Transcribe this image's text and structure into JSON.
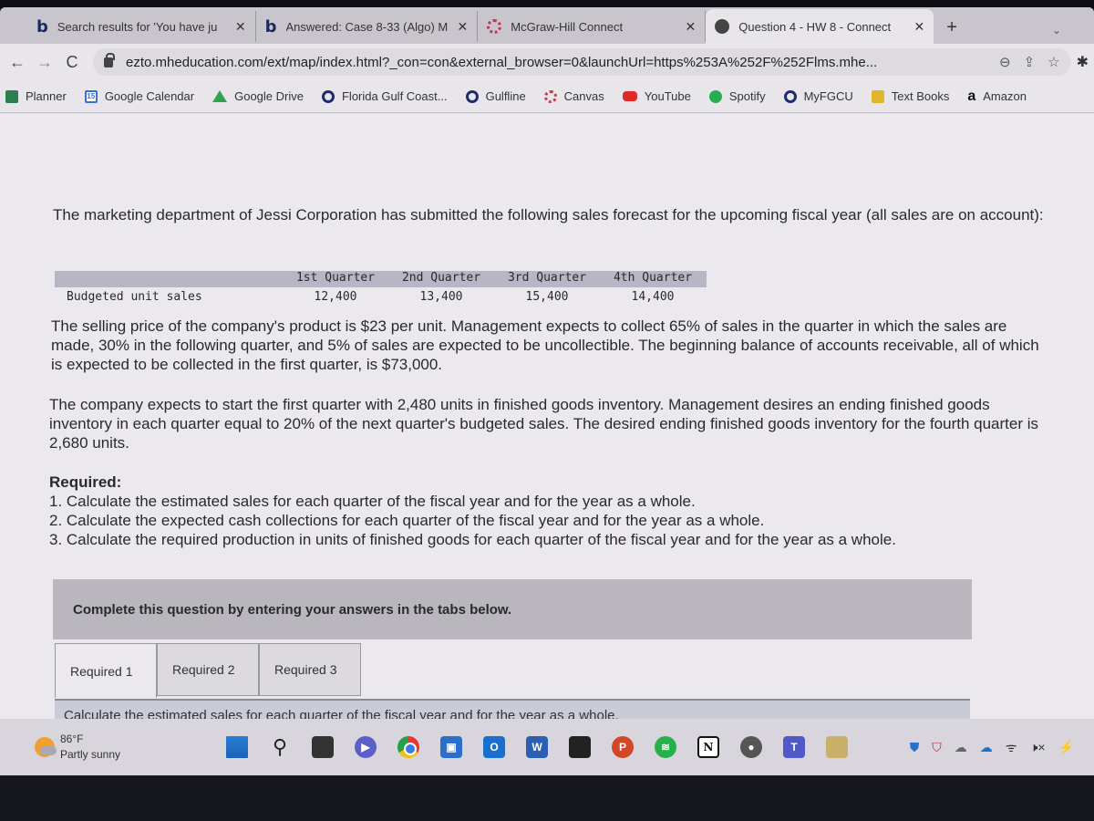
{
  "browser": {
    "tabs": [
      {
        "icon": "bing-icon",
        "favicon_glyph": "b",
        "label": "Search results for 'You have ju",
        "active": false
      },
      {
        "icon": "bing-icon",
        "favicon_glyph": "b",
        "label": "Answered: Case 8-33 (Algo) M",
        "active": false
      },
      {
        "icon": "mcgraw-hill-icon",
        "label": "McGraw-Hill Connect",
        "active": false
      },
      {
        "icon": "globe-icon",
        "label": "Question 4 - HW 8 - Connect",
        "active": true
      }
    ],
    "close_glyph": "✕",
    "new_tab_glyph": "+",
    "tab_dropdown_glyph": "⌄",
    "nav": {
      "back": "←",
      "forward": "→",
      "reload": "C"
    },
    "url": "ezto.mheducation.com/ext/map/index.html?_con=con&external_browser=0&launchUrl=https%253A%252F%252Flms.mhe...",
    "omnibox_icons": {
      "zoom": "⊖",
      "share": "⇪",
      "star": "☆",
      "extensions": "✱"
    },
    "bookmarks": [
      {
        "icon": "planner-icon",
        "label": "Planner"
      },
      {
        "icon": "google-calendar-icon",
        "label": "Google Calendar",
        "icon_text": "15"
      },
      {
        "icon": "google-drive-icon",
        "label": "Google Drive"
      },
      {
        "icon": "fgcu-icon",
        "label": "Florida Gulf Coast..."
      },
      {
        "icon": "fgcu-icon",
        "label": "Gulfline"
      },
      {
        "icon": "canvas-icon",
        "label": "Canvas"
      },
      {
        "icon": "youtube-icon",
        "label": "YouTube"
      },
      {
        "icon": "spotify-icon",
        "label": "Spotify"
      },
      {
        "icon": "fgcu-icon",
        "label": "MyFGCU"
      },
      {
        "icon": "text-books-icon",
        "label": "Text Books"
      },
      {
        "icon": "amazon-icon",
        "label": "Amazon",
        "icon_text": "a"
      }
    ]
  },
  "question": {
    "intro": "The marketing department of Jessi Corporation has submitted the following sales forecast for the upcoming fiscal year (all sales are on account):",
    "table": {
      "row_label": "Budgeted unit sales",
      "headers": [
        "1st Quarter",
        "2nd Quarter",
        "3rd Quarter",
        "4th Quarter"
      ],
      "values": [
        "12,400",
        "13,400",
        "15,400",
        "14,400"
      ]
    },
    "paragraph2": "The selling price of the company's product is $23 per unit. Management expects to collect 65% of sales in the quarter in which the sales are made, 30% in the following quarter, and 5% of sales are expected to be uncollectible. The beginning balance of accounts receivable, all of which is expected to be collected in the first quarter, is $73,000.",
    "paragraph3": "The company expects to start the first quarter with 2,480 units in finished goods inventory. Management desires an ending finished goods inventory in each quarter equal to 20% of the next quarter's budgeted sales. The desired ending finished goods inventory for the fourth quarter is 2,680 units.",
    "required_title": "Required:",
    "required_items": [
      "1. Calculate the estimated sales for each quarter of the fiscal year and for the year as a whole.",
      "2. Calculate the expected cash collections for each quarter of the fiscal year and for the year as a whole.",
      "3. Calculate the required production in units of finished goods for each quarter of the fiscal year and for the year as a whole."
    ],
    "complete_banner": "Complete this question by entering your answers in the tabs below.",
    "answer_tabs": [
      {
        "label": "Required 1",
        "active": true
      },
      {
        "label": "Required 2",
        "active": false
      },
      {
        "label": "Required 3",
        "active": false
      }
    ],
    "instruction": "Calculate the estimated sales for each quarter of the fiscal year and for the year as a whole."
  },
  "taskbar": {
    "weather": {
      "temp": "86°F",
      "condition": "Partly sunny"
    },
    "apps": [
      {
        "icon": "windows-start-icon",
        "glyph": ""
      },
      {
        "icon": "search-icon",
        "glyph": "⚲"
      },
      {
        "icon": "task-view-icon",
        "glyph": ""
      },
      {
        "icon": "teams-meet-icon",
        "glyph": "▶"
      },
      {
        "icon": "chrome-icon",
        "glyph": ""
      },
      {
        "icon": "phone-link-icon",
        "glyph": "▣"
      },
      {
        "icon": "outlook-icon",
        "glyph": "O"
      },
      {
        "icon": "word-icon",
        "glyph": "W"
      },
      {
        "icon": "sticky-notes-icon",
        "glyph": ""
      },
      {
        "icon": "powerpoint-icon",
        "glyph": "P"
      },
      {
        "icon": "spotify-icon",
        "glyph": "≋"
      },
      {
        "icon": "notion-icon",
        "glyph": "N"
      },
      {
        "icon": "settings-icon",
        "glyph": "●"
      },
      {
        "icon": "teams-icon",
        "glyph": "T"
      },
      {
        "icon": "money-app-icon",
        "glyph": ""
      }
    ],
    "tray": {
      "defender": "⛊",
      "mcafee": "⛉",
      "cloud": "☁",
      "onedrive": "☁",
      "wifi": "ᯤ",
      "volume": "🕨×",
      "battery": "⚡"
    }
  }
}
